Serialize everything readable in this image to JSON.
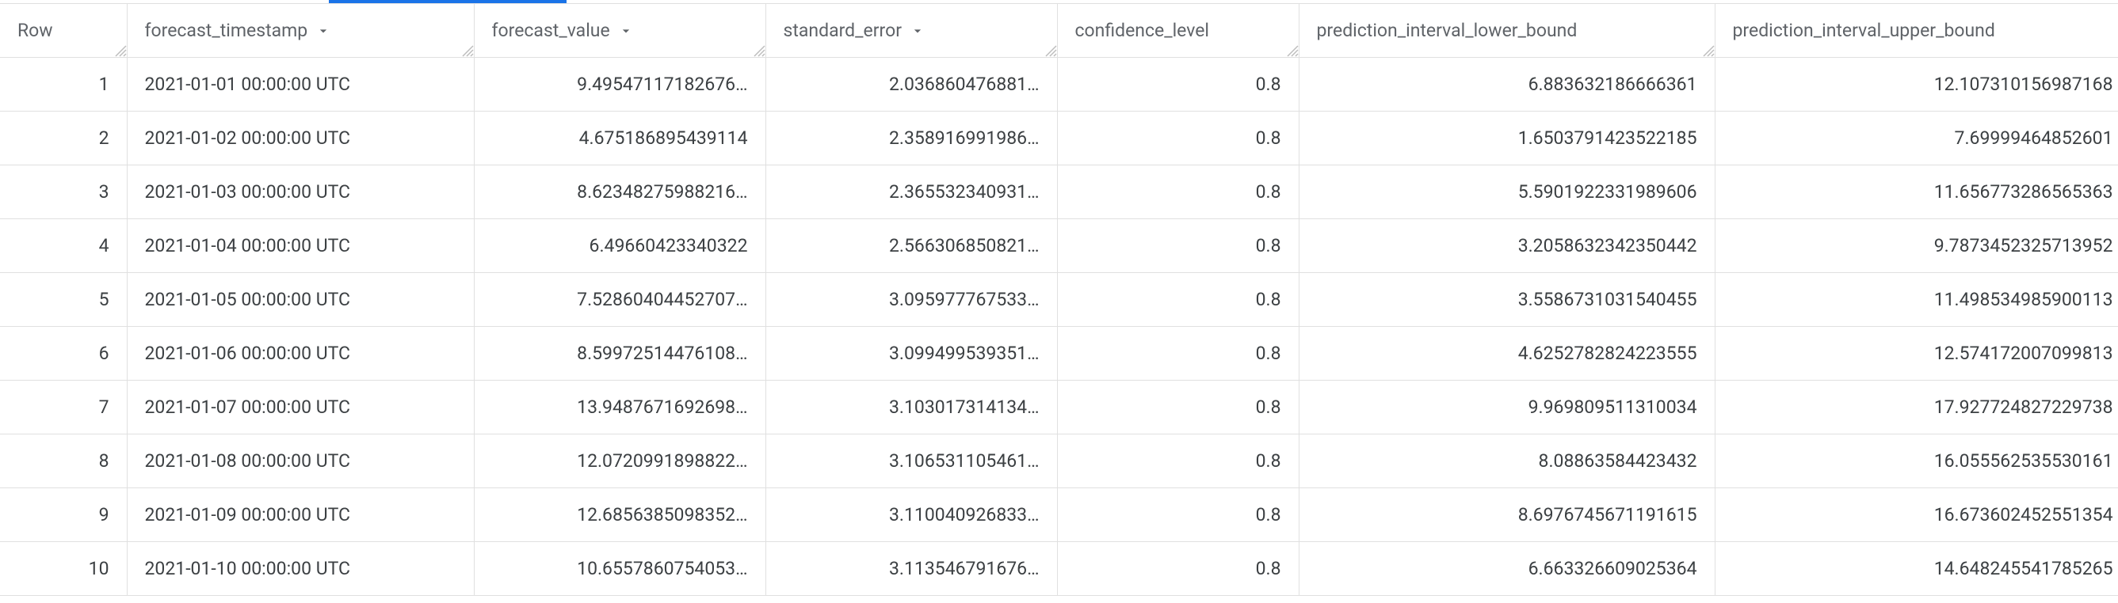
{
  "columns": [
    {
      "key": "row",
      "label": "Row",
      "align": "num",
      "dropdown": false,
      "cls": "col-row"
    },
    {
      "key": "ts",
      "label": "forecast_timestamp",
      "align": "txt",
      "dropdown": true,
      "cls": "col-ts"
    },
    {
      "key": "fv",
      "label": "forecast_value",
      "align": "num",
      "dropdown": true,
      "cls": "col-fv"
    },
    {
      "key": "se",
      "label": "standard_error",
      "align": "num",
      "dropdown": true,
      "cls": "col-se"
    },
    {
      "key": "cl",
      "label": "confidence_level",
      "align": "num",
      "dropdown": false,
      "cls": "col-cl"
    },
    {
      "key": "lo",
      "label": "prediction_interval_lower_bound",
      "align": "num",
      "dropdown": false,
      "cls": "col-lo"
    },
    {
      "key": "hi",
      "label": "prediction_interval_upper_bound",
      "align": "num",
      "dropdown": false,
      "cls": "col-hi"
    }
  ],
  "rows": [
    {
      "row": "1",
      "ts": "2021-01-01 00:00:00 UTC",
      "fv": "9.49547117182676…",
      "se": "2.036860476881…",
      "cl": "0.8",
      "lo": "6.883632186666361",
      "hi": "12.107310156987168"
    },
    {
      "row": "2",
      "ts": "2021-01-02 00:00:00 UTC",
      "fv": "4.675186895439114",
      "se": "2.358916991986…",
      "cl": "0.8",
      "lo": "1.6503791423522185",
      "hi": "7.69999464852601"
    },
    {
      "row": "3",
      "ts": "2021-01-03 00:00:00 UTC",
      "fv": "8.62348275988216…",
      "se": "2.365532340931…",
      "cl": "0.8",
      "lo": "5.5901922331989606",
      "hi": "11.656773286565363"
    },
    {
      "row": "4",
      "ts": "2021-01-04 00:00:00 UTC",
      "fv": "6.49660423340322",
      "se": "2.566306850821…",
      "cl": "0.8",
      "lo": "3.2058632342350442",
      "hi": "9.7873452325713952"
    },
    {
      "row": "5",
      "ts": "2021-01-05 00:00:00 UTC",
      "fv": "7.52860404452707…",
      "se": "3.095977767533…",
      "cl": "0.8",
      "lo": "3.5586731031540455",
      "hi": "11.498534985900113"
    },
    {
      "row": "6",
      "ts": "2021-01-06 00:00:00 UTC",
      "fv": "8.59972514476108…",
      "se": "3.099499539351…",
      "cl": "0.8",
      "lo": "4.6252782824223555",
      "hi": "12.574172007099813"
    },
    {
      "row": "7",
      "ts": "2021-01-07 00:00:00 UTC",
      "fv": "13.9487671692698…",
      "se": "3.103017314134…",
      "cl": "0.8",
      "lo": "9.969809511310034",
      "hi": "17.927724827229738"
    },
    {
      "row": "8",
      "ts": "2021-01-08 00:00:00 UTC",
      "fv": "12.0720991898822…",
      "se": "3.106531105461…",
      "cl": "0.8",
      "lo": "8.08863584423432",
      "hi": "16.055562535530161"
    },
    {
      "row": "9",
      "ts": "2021-01-09 00:00:00 UTC",
      "fv": "12.6856385098352…",
      "se": "3.110040926833…",
      "cl": "0.8",
      "lo": "8.6976745671191615",
      "hi": "16.673602452551354"
    },
    {
      "row": "10",
      "ts": "2021-01-10 00:00:00 UTC",
      "fv": "10.6557860754053…",
      "se": "3.113546791676…",
      "cl": "0.8",
      "lo": "6.663326609025364",
      "hi": "14.648245541785265"
    }
  ]
}
